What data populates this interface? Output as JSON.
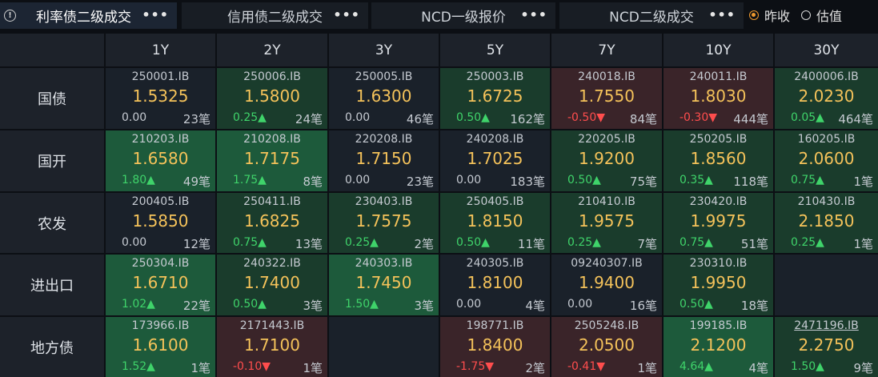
{
  "tabs": [
    {
      "label": "利率债二级成交",
      "more": "•••"
    },
    {
      "label": "信用债二级成交",
      "more": "•••"
    },
    {
      "label": "NCD一级报价",
      "more": "•••"
    },
    {
      "label": "NCD二级成交",
      "more": "•••"
    }
  ],
  "info_icon": "!",
  "radio": [
    {
      "label": "昨收",
      "checked": true
    },
    {
      "label": "估值",
      "checked": false
    }
  ],
  "columns": [
    "1Y",
    "2Y",
    "3Y",
    "5Y",
    "7Y",
    "10Y",
    "30Y"
  ],
  "rows": [
    {
      "label": "国债",
      "cells": [
        {
          "code": "250001.IB",
          "yield": "1.5325",
          "change": "0.00",
          "dir": "zero",
          "count": "23笔",
          "tone": "n"
        },
        {
          "code": "250006.IB",
          "yield": "1.5800",
          "change": "0.25▲",
          "dir": "up",
          "count": "24笔",
          "tone": "g"
        },
        {
          "code": "250005.IB",
          "yield": "1.6300",
          "change": "0.00",
          "dir": "zero",
          "count": "46笔",
          "tone": "n"
        },
        {
          "code": "250003.IB",
          "yield": "1.6725",
          "change": "0.50▲",
          "dir": "up",
          "count": "162笔",
          "tone": "g"
        },
        {
          "code": "240018.IB",
          "yield": "1.7550",
          "change": "-0.50▼",
          "dir": "dn",
          "count": "84笔",
          "tone": "r"
        },
        {
          "code": "240011.IB",
          "yield": "1.8030",
          "change": "-0.30▼",
          "dir": "dn",
          "count": "444笔",
          "tone": "r"
        },
        {
          "code": "2400006.IB",
          "yield": "2.0230",
          "change": "0.05▲",
          "dir": "up",
          "count": "464笔",
          "tone": "g"
        }
      ]
    },
    {
      "label": "国开",
      "cells": [
        {
          "code": "210203.IB",
          "yield": "1.6580",
          "change": "1.80▲",
          "dir": "up",
          "count": "49笔",
          "tone": "gg"
        },
        {
          "code": "210208.IB",
          "yield": "1.7175",
          "change": "1.75▲",
          "dir": "up",
          "count": "8笔",
          "tone": "gg"
        },
        {
          "code": "220208.IB",
          "yield": "1.7150",
          "change": "0.00",
          "dir": "zero",
          "count": "23笔",
          "tone": "n"
        },
        {
          "code": "240208.IB",
          "yield": "1.7025",
          "change": "0.00",
          "dir": "zero",
          "count": "183笔",
          "tone": "n"
        },
        {
          "code": "220205.IB",
          "yield": "1.9200",
          "change": "0.50▲",
          "dir": "up",
          "count": "75笔",
          "tone": "g"
        },
        {
          "code": "250205.IB",
          "yield": "1.8560",
          "change": "0.35▲",
          "dir": "up",
          "count": "118笔",
          "tone": "g"
        },
        {
          "code": "160205.IB",
          "yield": "2.0600",
          "change": "0.75▲",
          "dir": "up",
          "count": "1笔",
          "tone": "g"
        }
      ]
    },
    {
      "label": "农发",
      "cells": [
        {
          "code": "200405.IB",
          "yield": "1.5850",
          "change": "0.00",
          "dir": "zero",
          "count": "12笔",
          "tone": "n"
        },
        {
          "code": "250411.IB",
          "yield": "1.6825",
          "change": "0.75▲",
          "dir": "up",
          "count": "13笔",
          "tone": "g"
        },
        {
          "code": "230403.IB",
          "yield": "1.7575",
          "change": "0.25▲",
          "dir": "up",
          "count": "2笔",
          "tone": "g"
        },
        {
          "code": "250405.IB",
          "yield": "1.8150",
          "change": "0.50▲",
          "dir": "up",
          "count": "11笔",
          "tone": "g"
        },
        {
          "code": "210410.IB",
          "yield": "1.9575",
          "change": "0.25▲",
          "dir": "up",
          "count": "7笔",
          "tone": "g"
        },
        {
          "code": "230420.IB",
          "yield": "1.9975",
          "change": "0.75▲",
          "dir": "up",
          "count": "51笔",
          "tone": "g"
        },
        {
          "code": "210430.IB",
          "yield": "2.1850",
          "change": "0.25▲",
          "dir": "up",
          "count": "1笔",
          "tone": "g"
        }
      ]
    },
    {
      "label": "进出口",
      "cells": [
        {
          "code": "250304.IB",
          "yield": "1.6710",
          "change": "1.02▲",
          "dir": "up",
          "count": "22笔",
          "tone": "gg"
        },
        {
          "code": "240322.IB",
          "yield": "1.7400",
          "change": "0.50▲",
          "dir": "up",
          "count": "3笔",
          "tone": "g"
        },
        {
          "code": "240303.IB",
          "yield": "1.7450",
          "change": "1.50▲",
          "dir": "up",
          "count": "3笔",
          "tone": "gg"
        },
        {
          "code": "240305.IB",
          "yield": "1.8100",
          "change": "0.00",
          "dir": "zero",
          "count": "4笔",
          "tone": "n"
        },
        {
          "code": "09240307.IB",
          "yield": "1.9400",
          "change": "0.00",
          "dir": "zero",
          "count": "16笔",
          "tone": "n"
        },
        {
          "code": "230310.IB",
          "yield": "1.9950",
          "change": "0.50▲",
          "dir": "up",
          "count": "18笔",
          "tone": "g"
        },
        {
          "code": "",
          "yield": "",
          "change": "",
          "dir": "zero",
          "count": "",
          "tone": "e"
        }
      ]
    },
    {
      "label": "地方债",
      "cells": [
        {
          "code": "173966.IB",
          "yield": "1.6100",
          "change": "1.52▲",
          "dir": "up",
          "count": "1笔",
          "tone": "gg"
        },
        {
          "code": "2171443.IB",
          "yield": "1.7100",
          "change": "-0.10▼",
          "dir": "dn",
          "count": "1笔",
          "tone": "r"
        },
        {
          "code": "",
          "yield": "",
          "change": "",
          "dir": "zero",
          "count": "",
          "tone": "e"
        },
        {
          "code": "198771.IB",
          "yield": "1.8400",
          "change": "-1.75▼",
          "dir": "dn",
          "count": "2笔",
          "tone": "r"
        },
        {
          "code": "2505248.IB",
          "yield": "2.0500",
          "change": "-0.41▼",
          "dir": "dn",
          "count": "1笔",
          "tone": "r"
        },
        {
          "code": "199185.IB",
          "yield": "2.1200",
          "change": "4.64▲",
          "dir": "up",
          "count": "4笔",
          "tone": "gg"
        },
        {
          "code": "2471196.IB",
          "yield": "2.2750",
          "change": "1.50▲",
          "dir": "up",
          "count": "9笔",
          "tone": "g",
          "underline": true
        }
      ]
    }
  ]
}
